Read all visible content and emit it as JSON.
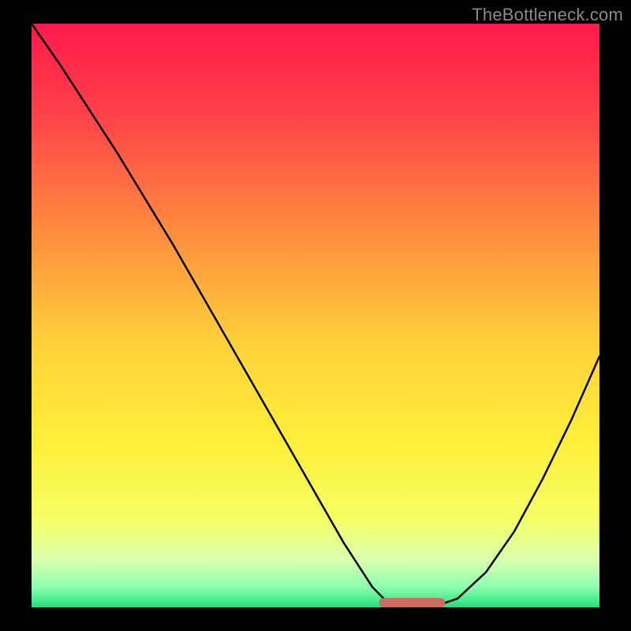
{
  "watermark": "TheBottleneck.com",
  "chart_data": {
    "type": "line",
    "title": "",
    "xlabel": "",
    "ylabel": "",
    "xlim": [
      0,
      100
    ],
    "ylim": [
      0,
      100
    ],
    "series": [
      {
        "name": "bottleneck-curve",
        "x": [
          0,
          5,
          10,
          15,
          20,
          25,
          30,
          35,
          40,
          45,
          50,
          55,
          60,
          62,
          64,
          66,
          68,
          70,
          72,
          75,
          80,
          85,
          90,
          95,
          100
        ],
        "y": [
          100,
          93,
          85.5,
          78,
          70,
          62,
          53.5,
          45,
          36.5,
          28,
          19.5,
          11,
          3.5,
          1.5,
          0.5,
          0.2,
          0.2,
          0.2,
          0.5,
          1.5,
          6,
          13,
          22,
          32,
          43
        ]
      }
    ],
    "flat_segment": {
      "name": "optimal-range",
      "x_start": 62,
      "x_end": 72,
      "y": 0.8,
      "color": "#cf6a63"
    },
    "gradient_stops": [
      {
        "pos": 0.0,
        "color": "#ff1a4b"
      },
      {
        "pos": 0.15,
        "color": "#ff3f4a"
      },
      {
        "pos": 0.35,
        "color": "#ff8a3e"
      },
      {
        "pos": 0.55,
        "color": "#ffd23a"
      },
      {
        "pos": 0.72,
        "color": "#ffef3a"
      },
      {
        "pos": 0.85,
        "color": "#f6ff66"
      },
      {
        "pos": 0.92,
        "color": "#d8ffb0"
      },
      {
        "pos": 0.965,
        "color": "#8cffb0"
      },
      {
        "pos": 1.0,
        "color": "#22e07a"
      }
    ]
  }
}
